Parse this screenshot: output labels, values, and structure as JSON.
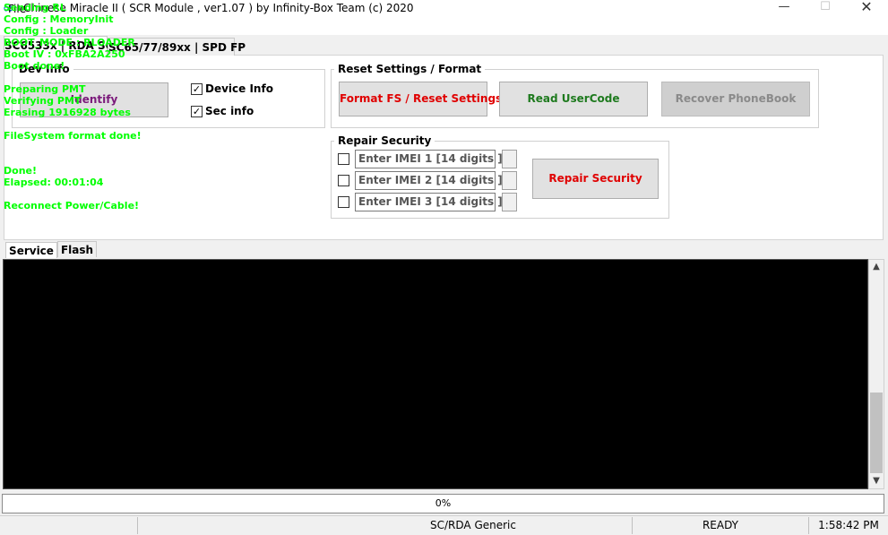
{
  "window": {
    "title": "Chinese Miracle II ( SCR Module , ver1.07  ) by Infinity-Box Team (c) 2020",
    "app_icon": "infinity-icon",
    "minimize": "—",
    "maximize": "☐",
    "close": "✕"
  },
  "menu": {
    "file": "File"
  },
  "tabs": [
    {
      "label": "SC6533x | RDA SC",
      "active": true
    },
    {
      "label": "SC65/77/89xx | SPD FP",
      "active": false
    }
  ],
  "dev_info": {
    "title": "Dev Info",
    "identify_label": "Identify",
    "identify_color": "#7b1a7b",
    "device_info": {
      "label": "Device Info",
      "checked": true
    },
    "sec_info": {
      "label": "Sec info",
      "checked": true
    }
  },
  "reset_settings": {
    "title": "Reset Settings / Format",
    "format_label": "Format FS / Reset Settings",
    "format_color": "#e00000",
    "read_usercode_label": "Read UserCode",
    "read_usercode_color": "#1e7a1e",
    "recover_phonebook_label": "Recover PhoneBook",
    "recover_phonebook_color": "#8a8a8a"
  },
  "repair_security": {
    "title": "Repair Security",
    "imei_fields": [
      {
        "placeholder": "Enter IMEI 1 [14 digits ]",
        "checked": false
      },
      {
        "placeholder": "Enter IMEI 2 [14 digits ]",
        "checked": false
      },
      {
        "placeholder": "Enter IMEI 3 [14 digits ]",
        "checked": false
      }
    ],
    "repair_label": "Repair Security",
    "repair_color": "#e00000"
  },
  "bottom_tabs": [
    {
      "label": "Service",
      "active": true
    },
    {
      "label": "Flash",
      "active": false
    }
  ],
  "console": {
    "text_color": "#00ff00",
    "lines": [
      "Sending RL",
      "Config : MemoryInit",
      "Config : Loader",
      "BOOT_MODE : RLOADER",
      "Boot IV  : 0xFBA2A250",
      "Boot done!",
      "",
      "Preparing PMT",
      "Verifying PMT",
      "Erasing 1916928 bytes",
      "",
      "FileSystem format done!",
      "",
      "",
      "Done!",
      "Elapsed: 00:01:04",
      "",
      "Reconnect Power/Cable!"
    ]
  },
  "progress": {
    "percent": 0,
    "label": "0%"
  },
  "status": {
    "segment1": "",
    "chip": "SC/RDA Generic",
    "segment3": "",
    "state": "READY",
    "time": "1:58:42 PM"
  }
}
